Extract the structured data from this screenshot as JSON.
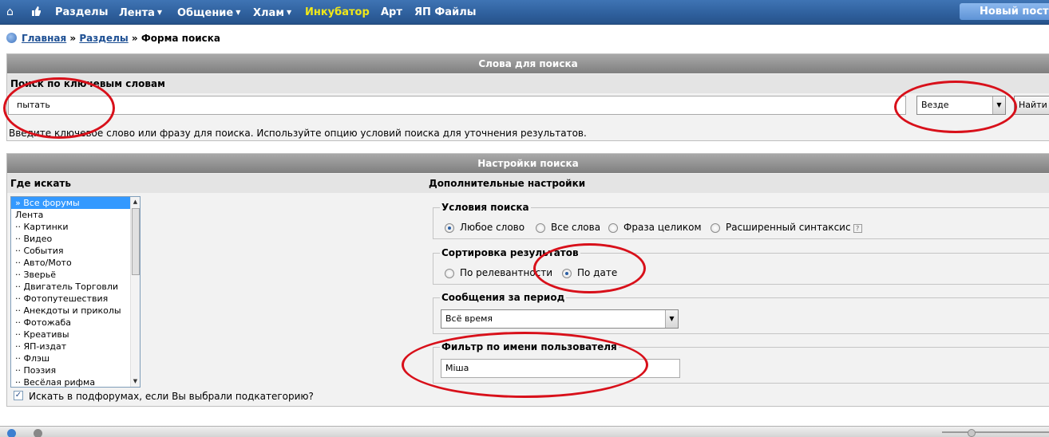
{
  "nav": {
    "items": [
      {
        "label": "Разделы",
        "caret": false
      },
      {
        "label": "Лента",
        "caret": true
      },
      {
        "label": "Общение",
        "caret": true
      },
      {
        "label": "Хлам",
        "caret": true
      },
      {
        "label": "Инкубатор",
        "caret": false
      },
      {
        "label": "Арт",
        "caret": false
      },
      {
        "label": "ЯП Файлы",
        "caret": false
      }
    ],
    "home_icon": "home-icon",
    "like_icon": "thumbs-up-icon",
    "caret": "▼",
    "new_post": "Новый пост"
  },
  "breadcrumb": {
    "home": "Главная",
    "sep": "»",
    "sections": "Разделы",
    "current": "Форма поиска"
  },
  "search_words": {
    "title": "Слова для поиска",
    "subtitle": "Поиск по ключевым словам",
    "keyword_value": "пытать",
    "scope_value": "Везде",
    "find_button": "Найти",
    "hint": "Введите ключевое слово или фразу для поиска. Используйте опцию условий поиска для уточнения результатов."
  },
  "settings": {
    "title": "Настройки поиска",
    "where_label": "Где искать",
    "extra_label": "Дополнительные настройки",
    "forums": [
      "» Все форумы",
      "Лента",
      "·· Картинки",
      "·· Видео",
      "·· События",
      "·· Авто/Мото",
      "·· Зверьё",
      "·· Двигатель Торговли",
      "·· Фотопутешествия",
      "·· Анекдоты и приколы",
      "·· Фотожаба",
      "·· Креативы",
      "·· ЯП-издат",
      "·· Флэш",
      "·· Поэзия",
      "·· Весёлая рифма"
    ],
    "subforums_label": "Искать в подфорумах, если Вы выбрали подкатегорию?",
    "subforums_checked": true,
    "conditions": {
      "legend": "Условия поиска",
      "options": [
        "Любое слово",
        "Все слова",
        "Фраза целиком",
        "Расширенный синтаксис"
      ],
      "selected": "Любое слово",
      "help": "?"
    },
    "sort": {
      "legend": "Сортировка результатов",
      "options": [
        "По релевантности",
        "По дате"
      ],
      "selected": "По дате"
    },
    "period": {
      "legend": "Сообщения за период",
      "value": "Всё время"
    },
    "user_filter": {
      "legend": "Фильтр по имени пользователя",
      "value": "Міша"
    }
  },
  "annotation_color": "#d8101a"
}
